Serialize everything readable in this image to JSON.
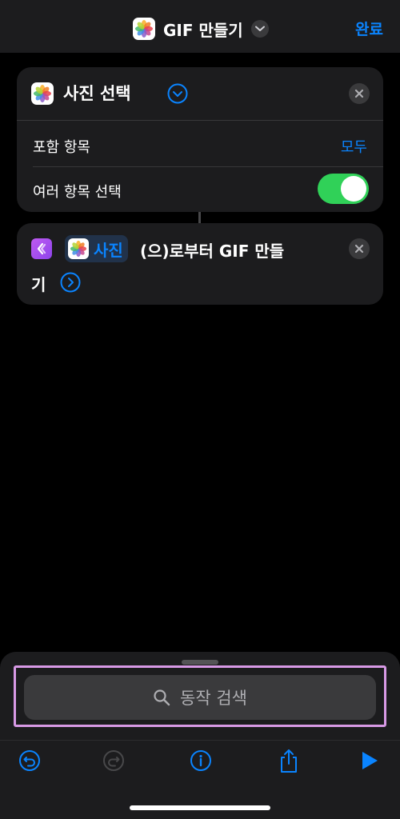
{
  "header": {
    "title": "GIF 만들기",
    "done_label": "완료"
  },
  "action1": {
    "title": "사진 선택",
    "rows": [
      {
        "label": "포함 항목",
        "value": "모두"
      },
      {
        "label": "여러 항목 선택",
        "toggle_on": true
      }
    ]
  },
  "action2": {
    "variable_label": "사진",
    "text_part1": "(으)로부터 GIF 만들",
    "text_part2": "기"
  },
  "bottom_sheet": {
    "search_placeholder": "동작 검색"
  },
  "toolbar": {
    "items": [
      "undo-icon",
      "redo-icon",
      "info-icon",
      "share-icon",
      "play-icon"
    ]
  },
  "colors": {
    "accent": "#0a84ff",
    "toggle_on": "#30d158",
    "card_bg": "#1c1c1e",
    "highlight_outline": "#d89ae6"
  }
}
